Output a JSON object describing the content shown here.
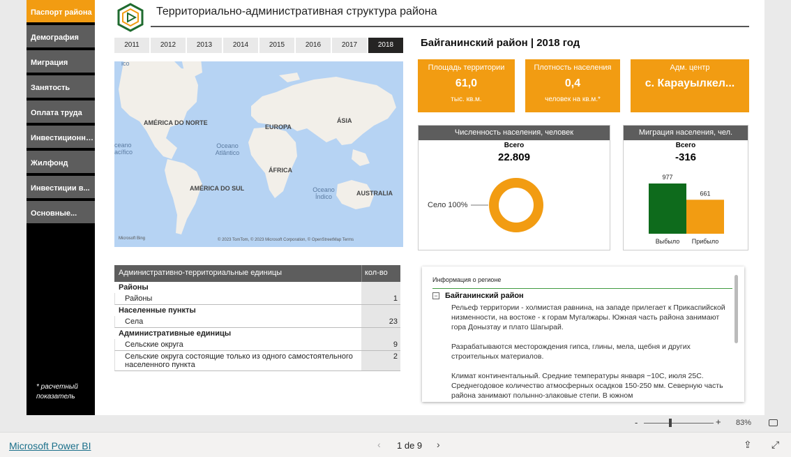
{
  "nav": {
    "items": [
      {
        "label": "Паспорт района",
        "active": true
      },
      {
        "label": "Демография",
        "active": false
      },
      {
        "label": "Миграция",
        "active": false
      },
      {
        "label": "Занятость",
        "active": false
      },
      {
        "label": "Оплата труда",
        "active": false
      },
      {
        "label": "Инвестиционна...",
        "active": false
      },
      {
        "label": "Жилфонд",
        "active": false
      },
      {
        "label": "Инвестиции в...",
        "active": false
      },
      {
        "label": "Основные...",
        "active": false
      }
    ],
    "note": "* расчетный показатель"
  },
  "header": {
    "title": "Территориально-административная структура района",
    "logo_icon": "play-hexagon-logo"
  },
  "years": {
    "items": [
      "2011",
      "2012",
      "2013",
      "2014",
      "2015",
      "2016",
      "2017",
      "2018"
    ],
    "selected": "2018"
  },
  "map": {
    "labels": {
      "north_america": "AMÉRICA DO NORTE",
      "europe": "EUROPA",
      "asia": "ÁSIA",
      "africa": "ÁFRICA",
      "south_america": "AMÉRICA DO SUL",
      "australia": "AUSTRALIA",
      "atlantic": "Oceano Atlântico",
      "indian": "Oceano Índico",
      "pacific_left": "ceano\nacífico",
      "top_left": "ico"
    },
    "credit": "© 2023 TomTom, © 2023 Microsoft Corporation, © OpenStreetMap  Terms",
    "brand": "Microsoft Bing"
  },
  "region_title": "Байганинский район | 2018 год",
  "kpis": {
    "area": {
      "label": "Площадь территории",
      "value": "61,0",
      "unit": "тыс. кв.м."
    },
    "density": {
      "label": "Плотность населения",
      "value": "0,4",
      "unit": "человек на кв.м.*"
    },
    "center": {
      "label": "Адм. центр",
      "value": "с. Карауылкел..."
    }
  },
  "population": {
    "title": "Численность населения, человек",
    "total_label": "Всего",
    "total_value": "22.809",
    "slice_label": "Село 100%",
    "colors": {
      "village": "#f29c12"
    }
  },
  "migration": {
    "title": "Миграция населения, чел.",
    "total_label": "Всего",
    "total_value": "-316"
  },
  "chart_data": {
    "type": "bar",
    "categories": [
      "Выбыло",
      "Прибыло"
    ],
    "values": [
      977,
      661
    ],
    "data_labels": [
      "977",
      "661"
    ],
    "colors": [
      "#0e6b1c",
      "#f29c12"
    ]
  },
  "table": {
    "headers": [
      "Административно-территориальные единицы",
      "кол-во"
    ],
    "rows": [
      {
        "type": "group",
        "label": "Районы",
        "value": ""
      },
      {
        "type": "item",
        "label": "Районы",
        "value": "1"
      },
      {
        "type": "group",
        "label": "Населенные пункты",
        "value": ""
      },
      {
        "type": "item",
        "label": "Села",
        "value": "23"
      },
      {
        "type": "group",
        "label": "Административные единицы",
        "value": ""
      },
      {
        "type": "item",
        "label": "Сельские округа",
        "value": "9"
      },
      {
        "type": "item",
        "label": "Сельские округа состоящие только из одного самостоятельного населенного пункта",
        "value": "2"
      }
    ]
  },
  "info": {
    "header": "Информация о регионе",
    "region": "Байганинский район",
    "paragraphs": [
      "Рельеф территории - холмистая равнина, на западе прилегает к Прикаспийской низменности, на востоке - к горам Мугалжары. Южная часть района занимают гора Донызтау и плато Шагырай.",
      "Разрабатываются месторождения гипса, глины, мела, щебня и других строительных материалов.",
      "Климат континентальный. Средние температуры января −10С, июля 25С. Среднегодовое количество атмосферных осадков 150-250 мм. Северную часть района занимают полынно-злаковые степи. В южном"
    ]
  },
  "zoom": {
    "minus": "-",
    "plus": "+",
    "percent": "83%",
    "level": 0.38
  },
  "footer": {
    "brand_link": "Microsoft Power BI",
    "page_text": "1 de 9"
  }
}
